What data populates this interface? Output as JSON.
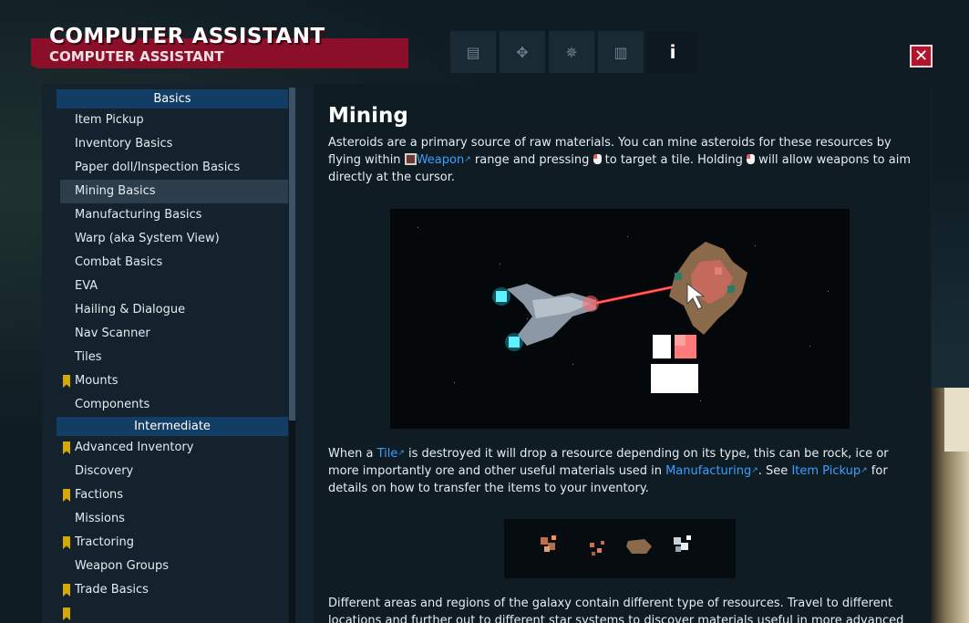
{
  "window": {
    "title": "COMPUTER ASSISTANT",
    "subtitle": "COMPUTER ASSISTANT",
    "close_label": "✕"
  },
  "tabs": [
    {
      "icon": "document-icon",
      "glyph": "▤",
      "active": false
    },
    {
      "icon": "handshake-icon",
      "glyph": "✥",
      "active": false
    },
    {
      "icon": "globe-icon",
      "glyph": "✵",
      "active": false
    },
    {
      "icon": "bar-chart-icon",
      "glyph": "▥",
      "active": false
    },
    {
      "icon": "info-icon",
      "glyph": "i",
      "active": true
    }
  ],
  "sidebar": {
    "sections": [
      {
        "header": "Basics",
        "items": [
          {
            "label": "Item Pickup",
            "flag": false,
            "selected": false
          },
          {
            "label": "Inventory Basics",
            "flag": false,
            "selected": false
          },
          {
            "label": "Paper doll/Inspection Basics",
            "flag": false,
            "selected": false
          },
          {
            "label": "Mining Basics",
            "flag": false,
            "selected": true
          },
          {
            "label": "Manufacturing Basics",
            "flag": false,
            "selected": false
          },
          {
            "label": "Warp (aka System View)",
            "flag": false,
            "selected": false
          },
          {
            "label": "Combat Basics",
            "flag": false,
            "selected": false
          },
          {
            "label": "EVA",
            "flag": false,
            "selected": false
          },
          {
            "label": "Hailing & Dialogue",
            "flag": false,
            "selected": false
          },
          {
            "label": "Nav Scanner",
            "flag": false,
            "selected": false
          },
          {
            "label": "Tiles",
            "flag": false,
            "selected": false
          },
          {
            "label": "Mounts",
            "flag": true,
            "selected": false
          },
          {
            "label": "Components",
            "flag": false,
            "selected": false
          }
        ]
      },
      {
        "header": "Intermediate",
        "items": [
          {
            "label": "Advanced Inventory",
            "flag": true,
            "selected": false
          },
          {
            "label": "Discovery",
            "flag": false,
            "selected": false
          },
          {
            "label": "Factions",
            "flag": true,
            "selected": false
          },
          {
            "label": "Missions",
            "flag": false,
            "selected": false
          },
          {
            "label": "Tractoring",
            "flag": true,
            "selected": false
          },
          {
            "label": "Weapon Groups",
            "flag": false,
            "selected": false
          },
          {
            "label": "Trade Basics",
            "flag": true,
            "selected": false
          },
          {
            "label": "",
            "flag": true,
            "selected": false
          }
        ]
      }
    ]
  },
  "content": {
    "title": "Mining",
    "p1": {
      "a": "Asteroids are a primary source of raw materials. You can mine asteroids for these resources by flying within ",
      "weapon_link": "Weapon",
      "b": " range and pressing ",
      "c": " to target a tile.  Holding ",
      "d": " will allow weapons to aim directly at the cursor."
    },
    "p2": {
      "a": "When a ",
      "tile_link": "Tile",
      "b": " is destroyed it will drop a resource depending on its type, this can be rock, ice or more importantly ore and other useful materials used in ",
      "manufacturing_link": "Manufacturing",
      "c": ". See ",
      "item_pickup_link": "Item Pickup",
      "d": " for details on how to transfer the items to your inventory."
    },
    "p3": "Different areas and regions of the galaxy contain different type of resources. Travel to different locations and further out to different star systems to discover materials useful in more advanced"
  },
  "colors": {
    "accent_red": "#8c0f2a",
    "section_blue": "#123e66",
    "link_blue": "#3aa0ff",
    "flag_gold": "#d6a900"
  }
}
